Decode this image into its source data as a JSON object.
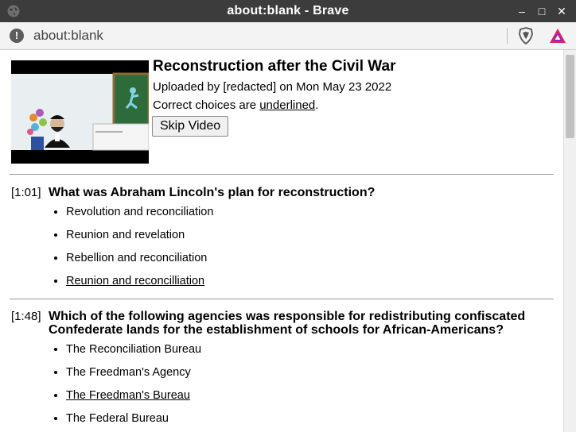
{
  "window": {
    "title": "about:blank - Brave",
    "controls": {
      "minimize": "–",
      "maximize": "□",
      "close": "✕"
    }
  },
  "addressbar": {
    "url": "about:blank"
  },
  "video": {
    "thumbnail_icon": "lincoln-classroom-illustration"
  },
  "header": {
    "title": "Reconstruction after the Civil War",
    "uploaded": "Uploaded by [redacted] on Mon May 23 2022",
    "correct_prefix": "Correct choices are ",
    "correct_word": "underlined",
    "correct_suffix": ".",
    "skip_label": "Skip Video"
  },
  "questions": [
    {
      "time": "[1:01]",
      "text": "What was Abraham Lincoln's plan for reconstruction?",
      "choices": [
        {
          "text": "Revolution and reconciliation",
          "correct": false
        },
        {
          "text": "Reunion and revelation",
          "correct": false
        },
        {
          "text": "Rebellion and reconciliation",
          "correct": false
        },
        {
          "text": "Reunion and reconcilliation",
          "correct": true
        }
      ]
    },
    {
      "time": "[1:48]",
      "text": "Which of the following agencies was responsible for redistributing confiscated Confederate lands for the establishment of schools for African-Americans?",
      "choices": [
        {
          "text": "The Reconciliation Bureau",
          "correct": false
        },
        {
          "text": "The Freedman's Agency",
          "correct": false
        },
        {
          "text": "The Freedman's Bureau",
          "correct": true
        },
        {
          "text": "The Federal Bureau",
          "correct": false
        }
      ]
    }
  ]
}
